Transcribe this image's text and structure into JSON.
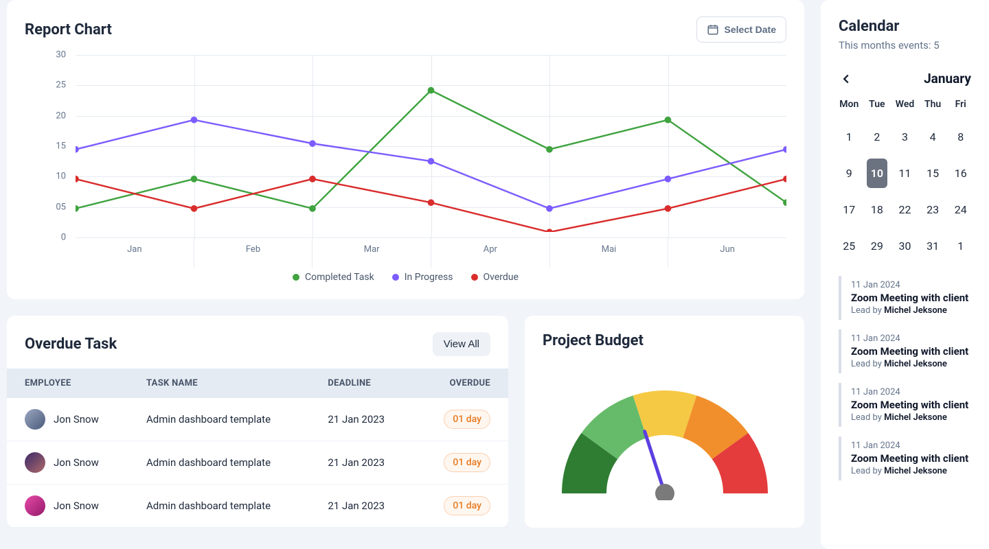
{
  "report": {
    "title": "Report Chart",
    "select_date_label": "Select Date"
  },
  "chart_data": {
    "type": "line",
    "x": [
      "Jan",
      "Feb",
      "Mar",
      "Apr",
      "Mai",
      "Jun"
    ],
    "xlabel": "",
    "ylabel": "",
    "ylim": [
      0,
      30
    ],
    "yticks": [
      0,
      5,
      10,
      15,
      20,
      25,
      30
    ],
    "series": [
      {
        "name": "Completed Task",
        "color": "#3fa33f",
        "values": [
          4,
          9,
          4,
          24,
          14,
          19,
          5
        ]
      },
      {
        "name": "In Progress",
        "color": "#7c5cff",
        "values": [
          14,
          19,
          15,
          12,
          4,
          9,
          14
        ]
      },
      {
        "name": "Overdue",
        "color": "#d92c2c",
        "values": [
          9,
          4,
          9,
          5,
          0,
          4,
          9
        ]
      }
    ]
  },
  "overdue": {
    "title": "Overdue Task",
    "view_all_label": "View All",
    "columns": {
      "employee": "EMPLOYEE",
      "task": "TASK NAME",
      "deadline": "DEADLINE",
      "overdue": "OVERDUE"
    },
    "rows": [
      {
        "name": "Jon Snow",
        "task": "Admin dashboard template",
        "deadline": "21 Jan 2023",
        "overdue": "01 day",
        "avatar": [
          "#9aa7c1",
          "#4a5a7a"
        ]
      },
      {
        "name": "Jon Snow",
        "task": "Admin dashboard template",
        "deadline": "21 Jan 2023",
        "overdue": "01 day",
        "avatar": [
          "#3a2a6a",
          "#b06a6a"
        ]
      },
      {
        "name": "Jon Snow",
        "task": "Admin dashboard template",
        "deadline": "21 Jan 2023",
        "overdue": "01 day",
        "avatar": [
          "#e84aa8",
          "#921a6a"
        ]
      }
    ]
  },
  "budget": {
    "title": "Project Budget",
    "segments": [
      {
        "color": "#2f7d32"
      },
      {
        "color": "#66bb6a"
      },
      {
        "color": "#f6c945"
      },
      {
        "color": "#f18f2c"
      },
      {
        "color": "#e43c3c"
      }
    ],
    "needle_deg": 72
  },
  "calendar": {
    "title": "Calendar",
    "subtitle": "This months events: 5",
    "month_label": "January",
    "dow": [
      "Mon",
      "Tue",
      "Wed",
      "Thu",
      "Fri"
    ],
    "days": [
      [
        "1",
        "2",
        "3",
        "4"
      ],
      [
        "8",
        "9",
        "10",
        "11"
      ],
      [
        "15",
        "16",
        "17",
        "18"
      ],
      [
        "22",
        "23",
        "24",
        "25"
      ],
      [
        "29",
        "30",
        "31",
        "1"
      ]
    ],
    "selected": "10",
    "events": [
      {
        "date": "11 Jan 2024",
        "title": "Zoom Meeting with client",
        "lead_prefix": "Lead by ",
        "lead_name": "Michel Jeksone"
      },
      {
        "date": "11 Jan 2024",
        "title": "Zoom Meeting with client",
        "lead_prefix": "Lead by ",
        "lead_name": "Michel Jeksone"
      },
      {
        "date": "11 Jan 2024",
        "title": "Zoom Meeting with client",
        "lead_prefix": "Lead by ",
        "lead_name": "Michel Jeksone"
      },
      {
        "date": "11 Jan 2024",
        "title": "Zoom Meeting with client",
        "lead_prefix": "Lead by ",
        "lead_name": "Michel Jeksone"
      }
    ]
  }
}
